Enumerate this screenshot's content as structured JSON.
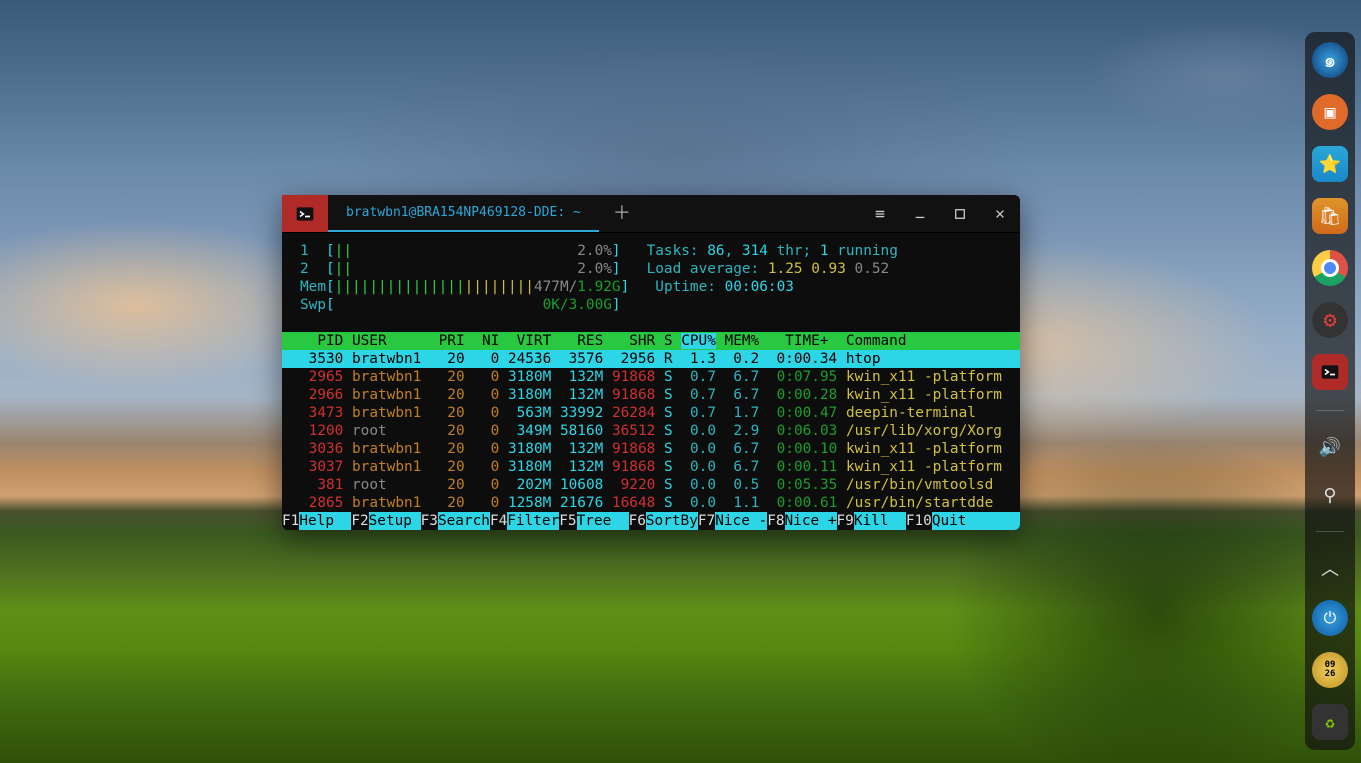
{
  "window": {
    "tab_title": "bratwbn1@BRA154NP469128-DDE: ~"
  },
  "htop": {
    "cpu": [
      {
        "id": "1",
        "bar": "||",
        "pct": "2.0%"
      },
      {
        "id": "2",
        "bar": "||",
        "pct": "2.0%"
      }
    ],
    "mem": {
      "label": "Mem",
      "bar": "|||||||||||||||||||||||",
      "used": "477M",
      "total": "1.92G"
    },
    "swp": {
      "label": "Swp",
      "used": "0K",
      "total": "3.00G"
    },
    "tasks_label": "Tasks:",
    "tasks": "86",
    "sep": ",",
    "thr": "314",
    "thr_label": "thr;",
    "running": "1",
    "running_label": "running",
    "load_label": "Load average:",
    "load1": "1.25",
    "load2": "0.93",
    "load3": "0.52",
    "uptime_label": "Uptime:",
    "uptime": "00:06:03",
    "headers": [
      "  PID",
      "USER     ",
      " PRI",
      " NI",
      " VIRT",
      "  RES",
      "  SHR",
      "S",
      "CPU%",
      "MEM%",
      "  TIME+ ",
      "Command"
    ],
    "rows": [
      {
        "sel": true,
        "pid": " 3530",
        "user": "bratwbn1",
        "pri": "  20",
        "ni": "  0",
        "virt": "24536",
        "res": " 3576",
        "shr": " 2956",
        "s": "R",
        "cpu": " 1.3",
        "mem": " 0.2",
        "time": " 0:00.34",
        "cmd": "htop"
      },
      {
        "sel": false,
        "pid": " 2965",
        "user": "bratwbn1",
        "pri": "  20",
        "ni": "  0",
        "virt": "3180M",
        "res": " 132M",
        "shr": "91868",
        "s": "S",
        "cpu": " 0.7",
        "mem": " 6.7",
        "time": " 0:07.95",
        "cmd": "kwin_x11 -platform"
      },
      {
        "sel": false,
        "pid": " 2966",
        "user": "bratwbn1",
        "pri": "  20",
        "ni": "  0",
        "virt": "3180M",
        "res": " 132M",
        "shr": "91868",
        "s": "S",
        "cpu": " 0.7",
        "mem": " 6.7",
        "time": " 0:00.28",
        "cmd": "kwin_x11 -platform"
      },
      {
        "sel": false,
        "pid": " 3473",
        "user": "bratwbn1",
        "pri": "  20",
        "ni": "  0",
        "virt": " 563M",
        "res": "33992",
        "shr": "26284",
        "s": "S",
        "cpu": " 0.7",
        "mem": " 1.7",
        "time": " 0:00.47",
        "cmd": "deepin-terminal"
      },
      {
        "sel": false,
        "pid": " 1200",
        "user": "root    ",
        "root": true,
        "pri": "  20",
        "ni": "  0",
        "virt": " 349M",
        "res": "58160",
        "shr": "36512",
        "s": "S",
        "cpu": " 0.0",
        "mem": " 2.9",
        "time": " 0:06.03",
        "cmd": "/usr/lib/xorg/Xorg"
      },
      {
        "sel": false,
        "pid": " 3036",
        "user": "bratwbn1",
        "pri": "  20",
        "ni": "  0",
        "virt": "3180M",
        "res": " 132M",
        "shr": "91868",
        "s": "S",
        "cpu": " 0.0",
        "mem": " 6.7",
        "time": " 0:00.10",
        "cmd": "kwin_x11 -platform"
      },
      {
        "sel": false,
        "pid": " 3037",
        "user": "bratwbn1",
        "pri": "  20",
        "ni": "  0",
        "virt": "3180M",
        "res": " 132M",
        "shr": "91868",
        "s": "S",
        "cpu": " 0.0",
        "mem": " 6.7",
        "time": " 0:00.11",
        "cmd": "kwin_x11 -platform"
      },
      {
        "sel": false,
        "pid": "  381",
        "user": "root    ",
        "root": true,
        "pri": "  20",
        "ni": "  0",
        "virt": " 202M",
        "res": "10608",
        "shr": " 9220",
        "s": "S",
        "cpu": " 0.0",
        "mem": " 0.5",
        "time": " 0:05.35",
        "cmd": "/usr/bin/vmtoolsd"
      },
      {
        "sel": false,
        "pid": " 2865",
        "user": "bratwbn1",
        "pri": "  20",
        "ni": "  0",
        "virt": "1258M",
        "res": "21676",
        "shr": "16648",
        "s": "S",
        "cpu": " 0.0",
        "mem": " 1.1",
        "time": " 0:00.61",
        "cmd": "/usr/bin/startdde"
      }
    ],
    "footer": [
      {
        "k": "F1",
        "l": "Help  "
      },
      {
        "k": "F2",
        "l": "Setup "
      },
      {
        "k": "F3",
        "l": "Search"
      },
      {
        "k": "F4",
        "l": "Filter"
      },
      {
        "k": "F5",
        "l": "Tree  "
      },
      {
        "k": "F6",
        "l": "SortBy"
      },
      {
        "k": "F7",
        "l": "Nice -"
      },
      {
        "k": "F8",
        "l": "Nice +"
      },
      {
        "k": "F9",
        "l": "Kill  "
      },
      {
        "k": "F10",
        "l": "Quit  "
      }
    ]
  },
  "dock": {
    "items": [
      {
        "name": "deepin-launcher",
        "cls": "di-deepin"
      },
      {
        "name": "multitasking-view",
        "cls": "di-orange"
      },
      {
        "name": "app-store",
        "cls": "di-store"
      },
      {
        "name": "software-center",
        "cls": "di-appstore"
      },
      {
        "name": "google-chrome",
        "cls": "di-chrome"
      },
      {
        "name": "settings",
        "cls": "di-settings"
      },
      {
        "name": "deepin-terminal",
        "cls": "di-term"
      }
    ],
    "tray": [
      {
        "name": "volume-icon",
        "glyph": "🔊"
      },
      {
        "name": "usb-icon",
        "glyph": "⚲"
      }
    ],
    "bottom": [
      {
        "name": "power-button",
        "cls": "di-power",
        "glyph": "⏻"
      },
      {
        "name": "clock",
        "cls": "di-clock",
        "glyph": "09:26"
      },
      {
        "name": "trash",
        "cls": "di-trash",
        "glyph": "♻"
      }
    ],
    "expand_glyph": "︿"
  }
}
